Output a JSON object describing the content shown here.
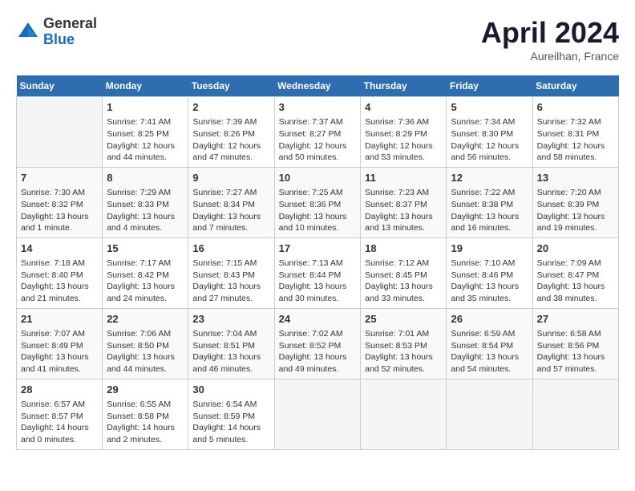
{
  "header": {
    "logo_general": "General",
    "logo_blue": "Blue",
    "month_title": "April 2024",
    "subtitle": "Aureilhan, France"
  },
  "columns": [
    "Sunday",
    "Monday",
    "Tuesday",
    "Wednesday",
    "Thursday",
    "Friday",
    "Saturday"
  ],
  "weeks": [
    [
      {
        "day": "",
        "text": ""
      },
      {
        "day": "1",
        "text": "Sunrise: 7:41 AM\nSunset: 8:25 PM\nDaylight: 12 hours and 44 minutes."
      },
      {
        "day": "2",
        "text": "Sunrise: 7:39 AM\nSunset: 8:26 PM\nDaylight: 12 hours and 47 minutes."
      },
      {
        "day": "3",
        "text": "Sunrise: 7:37 AM\nSunset: 8:27 PM\nDaylight: 12 hours and 50 minutes."
      },
      {
        "day": "4",
        "text": "Sunrise: 7:36 AM\nSunset: 8:29 PM\nDaylight: 12 hours and 53 minutes."
      },
      {
        "day": "5",
        "text": "Sunrise: 7:34 AM\nSunset: 8:30 PM\nDaylight: 12 hours and 56 minutes."
      },
      {
        "day": "6",
        "text": "Sunrise: 7:32 AM\nSunset: 8:31 PM\nDaylight: 12 hours and 58 minutes."
      }
    ],
    [
      {
        "day": "7",
        "text": "Sunrise: 7:30 AM\nSunset: 8:32 PM\nDaylight: 13 hours and 1 minute."
      },
      {
        "day": "8",
        "text": "Sunrise: 7:29 AM\nSunset: 8:33 PM\nDaylight: 13 hours and 4 minutes."
      },
      {
        "day": "9",
        "text": "Sunrise: 7:27 AM\nSunset: 8:34 PM\nDaylight: 13 hours and 7 minutes."
      },
      {
        "day": "10",
        "text": "Sunrise: 7:25 AM\nSunset: 8:36 PM\nDaylight: 13 hours and 10 minutes."
      },
      {
        "day": "11",
        "text": "Sunrise: 7:23 AM\nSunset: 8:37 PM\nDaylight: 13 hours and 13 minutes."
      },
      {
        "day": "12",
        "text": "Sunrise: 7:22 AM\nSunset: 8:38 PM\nDaylight: 13 hours and 16 minutes."
      },
      {
        "day": "13",
        "text": "Sunrise: 7:20 AM\nSunset: 8:39 PM\nDaylight: 13 hours and 19 minutes."
      }
    ],
    [
      {
        "day": "14",
        "text": "Sunrise: 7:18 AM\nSunset: 8:40 PM\nDaylight: 13 hours and 21 minutes."
      },
      {
        "day": "15",
        "text": "Sunrise: 7:17 AM\nSunset: 8:42 PM\nDaylight: 13 hours and 24 minutes."
      },
      {
        "day": "16",
        "text": "Sunrise: 7:15 AM\nSunset: 8:43 PM\nDaylight: 13 hours and 27 minutes."
      },
      {
        "day": "17",
        "text": "Sunrise: 7:13 AM\nSunset: 8:44 PM\nDaylight: 13 hours and 30 minutes."
      },
      {
        "day": "18",
        "text": "Sunrise: 7:12 AM\nSunset: 8:45 PM\nDaylight: 13 hours and 33 minutes."
      },
      {
        "day": "19",
        "text": "Sunrise: 7:10 AM\nSunset: 8:46 PM\nDaylight: 13 hours and 35 minutes."
      },
      {
        "day": "20",
        "text": "Sunrise: 7:09 AM\nSunset: 8:47 PM\nDaylight: 13 hours and 38 minutes."
      }
    ],
    [
      {
        "day": "21",
        "text": "Sunrise: 7:07 AM\nSunset: 8:49 PM\nDaylight: 13 hours and 41 minutes."
      },
      {
        "day": "22",
        "text": "Sunrise: 7:06 AM\nSunset: 8:50 PM\nDaylight: 13 hours and 44 minutes."
      },
      {
        "day": "23",
        "text": "Sunrise: 7:04 AM\nSunset: 8:51 PM\nDaylight: 13 hours and 46 minutes."
      },
      {
        "day": "24",
        "text": "Sunrise: 7:02 AM\nSunset: 8:52 PM\nDaylight: 13 hours and 49 minutes."
      },
      {
        "day": "25",
        "text": "Sunrise: 7:01 AM\nSunset: 8:53 PM\nDaylight: 13 hours and 52 minutes."
      },
      {
        "day": "26",
        "text": "Sunrise: 6:59 AM\nSunset: 8:54 PM\nDaylight: 13 hours and 54 minutes."
      },
      {
        "day": "27",
        "text": "Sunrise: 6:58 AM\nSunset: 8:56 PM\nDaylight: 13 hours and 57 minutes."
      }
    ],
    [
      {
        "day": "28",
        "text": "Sunrise: 6:57 AM\nSunset: 8:57 PM\nDaylight: 14 hours and 0 minutes."
      },
      {
        "day": "29",
        "text": "Sunrise: 6:55 AM\nSunset: 8:58 PM\nDaylight: 14 hours and 2 minutes."
      },
      {
        "day": "30",
        "text": "Sunrise: 6:54 AM\nSunset: 8:59 PM\nDaylight: 14 hours and 5 minutes."
      },
      {
        "day": "",
        "text": ""
      },
      {
        "day": "",
        "text": ""
      },
      {
        "day": "",
        "text": ""
      },
      {
        "day": "",
        "text": ""
      }
    ]
  ]
}
